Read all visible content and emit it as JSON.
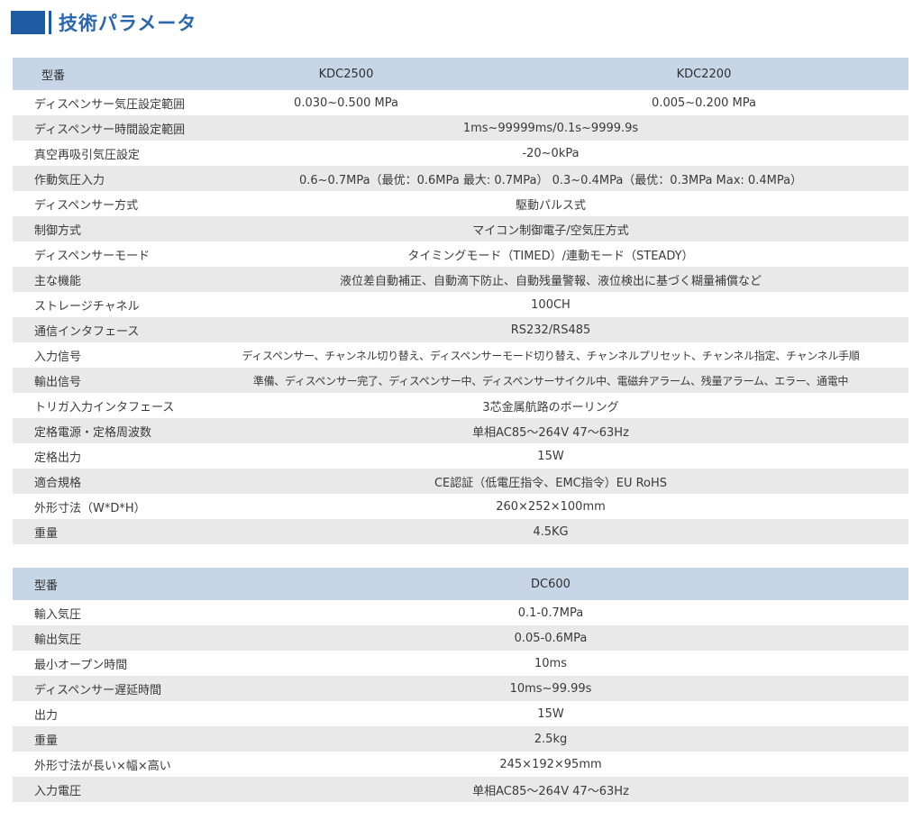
{
  "page": {
    "title": "技術パラメータ"
  },
  "table1": {
    "header": {
      "label": "型番",
      "col1": "KDC2500",
      "col2": "KDC2200"
    },
    "rows": [
      {
        "label": "ディスペンサー気圧設定範囲",
        "v1": "0.030~0.500 MPa",
        "v2": "0.005~0.200 MPa"
      },
      {
        "label": "ディスペンサー時間設定範囲",
        "value": "1ms~99999ms/0.1s~9999.9s"
      },
      {
        "label": "真空再吸引気圧設定",
        "value": "-20~0kPa"
      },
      {
        "label": "作動気圧入力",
        "value": "0.6~0.7MPa（最优：0.6MPa 最大: 0.7MPa） 0.3~0.4MPa（最优：0.3MPa Max: 0.4MPa）"
      },
      {
        "label": "ディスペンサー方式",
        "value": "駆動パルス式"
      },
      {
        "label": "制御方式",
        "value": "マイコン制御電子/空気圧方式"
      },
      {
        "label": "ディスペンサーモード",
        "value": "タイミングモード（TIMED）/連動モード（STEADY）"
      },
      {
        "label": "主な機能",
        "value": "液位差自動補正、自動滴下防止、自動残量警報、液位検出に基づく糊量補償など"
      },
      {
        "label": "ストレージチャネル",
        "value": "100CH"
      },
      {
        "label": "通信インタフェース",
        "value": "RS232/RS485"
      },
      {
        "label": "入力信号",
        "value": "ディスペンサー、チャンネル切り替え、ディスペンサーモード切り替え、チャンネルプリセット、チャンネル指定、チャンネル手順",
        "small": true
      },
      {
        "label": "輸出信号",
        "value": "準備、ディスペンサー完了、ディスペンサー中、ディスペンサーサイクル中、電磁弁アラーム、残量アラーム、エラー、通電中",
        "small": true
      },
      {
        "label": "トリガ入力インタフェース",
        "value": "3芯金属航路のボーリング"
      },
      {
        "label": "定格電源・定格周波数",
        "value": "单相AC85～264V 47～63Hz"
      },
      {
        "label": "定格出力",
        "value": "15W"
      },
      {
        "label": "適合規格",
        "value": "CE認証（低電圧指令、EMC指令）EU RoHS"
      },
      {
        "label": "外形寸法（W*D*H）",
        "value": "260×252×100mm"
      },
      {
        "label": "重量",
        "value": "4.5KG"
      }
    ]
  },
  "table2": {
    "header": {
      "label": "型番",
      "col1": "DC600"
    },
    "rows": [
      {
        "label": "輸入気圧",
        "value": "0.1-0.7MPa"
      },
      {
        "label": "輸出気圧",
        "value": "0.05-0.6MPa"
      },
      {
        "label": "最小オープン時間",
        "value": "10ms"
      },
      {
        "label": "ディスペンサー遅延時間",
        "value": "10ms~99.99s"
      },
      {
        "label": "出力",
        "value": "15W"
      },
      {
        "label": "重量",
        "value": "2.5kg"
      },
      {
        "label": "外形寸法が長い×幅×高い",
        "value": "245×192×95mm"
      },
      {
        "label": "入力電圧",
        "value": "单相AC85～264V 47～63Hz"
      }
    ]
  }
}
